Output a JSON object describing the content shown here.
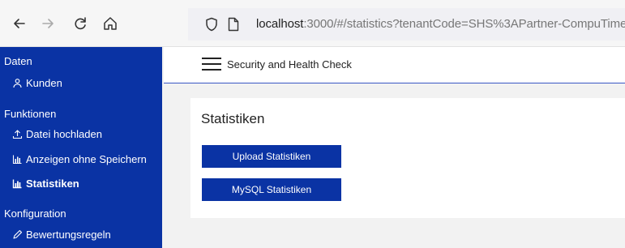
{
  "browser": {
    "url_host": "localhost",
    "url_rest": ":3000/#/statistics?tenantCode=SHS%3APartner-CompuTime"
  },
  "sidebar": {
    "sections": [
      {
        "label": "Daten",
        "items": [
          {
            "label": "Kunden",
            "icon": "user-icon"
          }
        ]
      },
      {
        "label": "Funktionen",
        "items": [
          {
            "label": "Datei hochladen",
            "icon": "upload-icon"
          },
          {
            "label": "Anzeigen ohne Speichern",
            "icon": "chart-icon"
          },
          {
            "label": "Statistiken",
            "icon": "chart-icon",
            "active": true
          }
        ]
      },
      {
        "label": "Konfiguration",
        "items": [
          {
            "label": "Bewertungsregeln",
            "icon": "pencil-icon"
          }
        ]
      }
    ]
  },
  "header": {
    "title": "Security and Health Check"
  },
  "main": {
    "title": "Statistiken",
    "buttons": {
      "upload": "Upload Statistiken",
      "mysql": "MySQL Statistiken"
    }
  },
  "colors": {
    "primary": "#0a33a4",
    "header_border": "#3b57c4"
  }
}
